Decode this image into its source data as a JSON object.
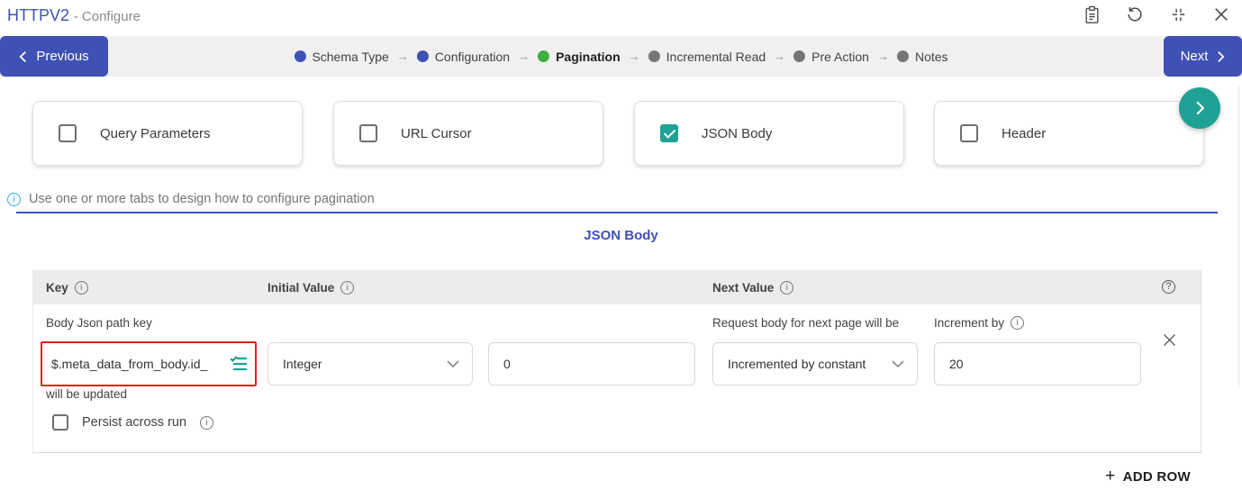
{
  "colors": {
    "primary_blue": "#3F51B5",
    "accent_teal": "#1FA295",
    "current_step_green": "#3FAE42",
    "info_cyan": "#36A9E1",
    "annotation_red": "#E02020"
  },
  "header": {
    "title": "HTTPV2",
    "subtitle": "- Configure"
  },
  "toolbar": {
    "previous_label": "Previous",
    "next_label": "Next"
  },
  "stepper": {
    "arrow": "→",
    "steps": [
      {
        "label": "Schema Type",
        "state": "done"
      },
      {
        "label": "Configuration",
        "state": "done"
      },
      {
        "label": "Pagination",
        "state": "current"
      },
      {
        "label": "Incremental Read",
        "state": "pending"
      },
      {
        "label": "Pre Action",
        "state": "pending"
      },
      {
        "label": "Notes",
        "state": "pending"
      }
    ]
  },
  "pagination_tabs": [
    {
      "label": "Query Parameters",
      "checked": false
    },
    {
      "label": "URL Cursor",
      "checked": false
    },
    {
      "label": "JSON Body",
      "checked": true
    },
    {
      "label": "Header",
      "checked": false
    }
  ],
  "info_text": "Use one or more tabs to design how to configure pagination",
  "section_title": "JSON Body",
  "table": {
    "col_key": "Key",
    "col_initial": "Initial Value",
    "col_next": "Next Value",
    "row": {
      "key_field_label": "Body Json path key",
      "key_value": "$.meta_data_from_body.id_",
      "key_field_suffix": "will be updated",
      "persist_label": "Persist across run",
      "persist_checked": false,
      "initial_type_selected": "Integer",
      "initial_value": "0",
      "next_field_label": "Request body for next page will be",
      "next_type_selected": "Incremented by constant",
      "increment_label": "Increment by",
      "increment_value": "20"
    },
    "add_row_plus": "+",
    "add_row_label": "ADD ROW"
  }
}
